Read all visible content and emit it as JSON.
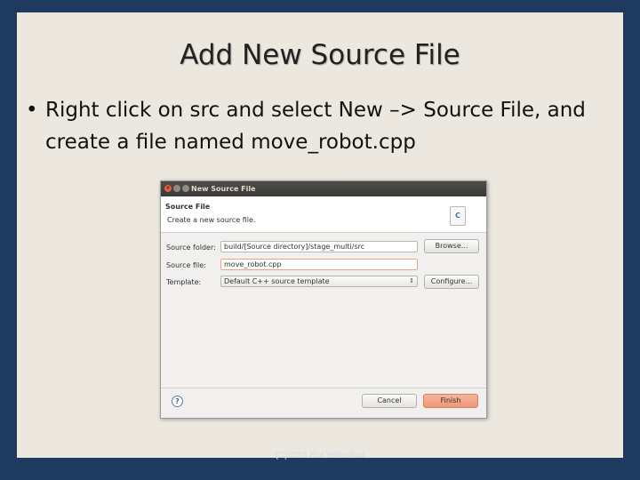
{
  "slide": {
    "title": "Add New Source File",
    "bullet_symbol": "•",
    "bullet_text": "Right click on src and select New –> Source File, and create a file named move_robot.cpp",
    "footer": "(C)2015 Roi Yehoshua"
  },
  "dialog": {
    "window_title": "New Source File",
    "header_title": "Source File",
    "header_description": "Create a new source file.",
    "header_icon_glyph": "C",
    "source_folder_label": "Source folder:",
    "source_folder_value": "build/[Source directory]/stage_multi/src",
    "browse_label": "Browse...",
    "source_file_label": "Source file:",
    "source_file_value": "move_robot.cpp",
    "template_label": "Template:",
    "template_value": "Default C++ source template",
    "configure_label": "Configure...",
    "cancel_label": "Cancel",
    "finish_label": "Finish",
    "help_glyph": "?",
    "close_glyph": "×"
  },
  "icons": {
    "help": "help-icon",
    "file": "c-source-file-icon",
    "close": "close-icon",
    "minimize": "minimize-icon",
    "maximize": "maximize-icon"
  },
  "colors": {
    "slide_background": "#ece8e0",
    "frame_background": "#1f3a5f",
    "finish_button": "#ef9777",
    "titlebar": "#3c3b37"
  }
}
